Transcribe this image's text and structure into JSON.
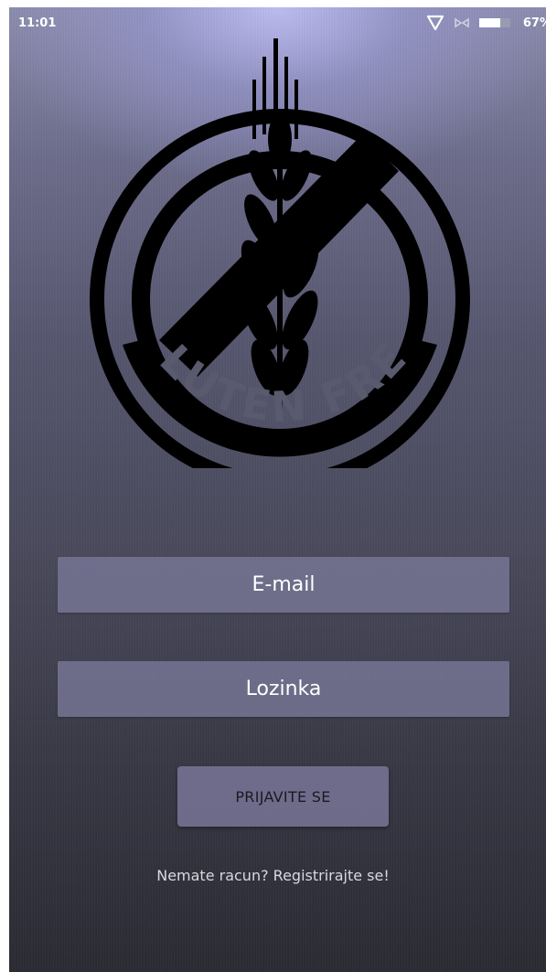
{
  "status_bar": {
    "time": "11:01",
    "battery_percent": "67%",
    "icons": [
      "vpn-icon",
      "nfc-icon",
      "battery-icon"
    ]
  },
  "logo": {
    "text": "GLUTEN FREE",
    "icon": "no-wheat-icon"
  },
  "form": {
    "email_placeholder": "E-mail",
    "password_placeholder": "Lozinka",
    "login_label": "PRIJAVITE SE",
    "register_text": "Nemate racun? Registrirajte se!"
  },
  "colors": {
    "field_bg": "#78769a",
    "text_light": "#ffffff",
    "button_text": "#1a1a22"
  }
}
